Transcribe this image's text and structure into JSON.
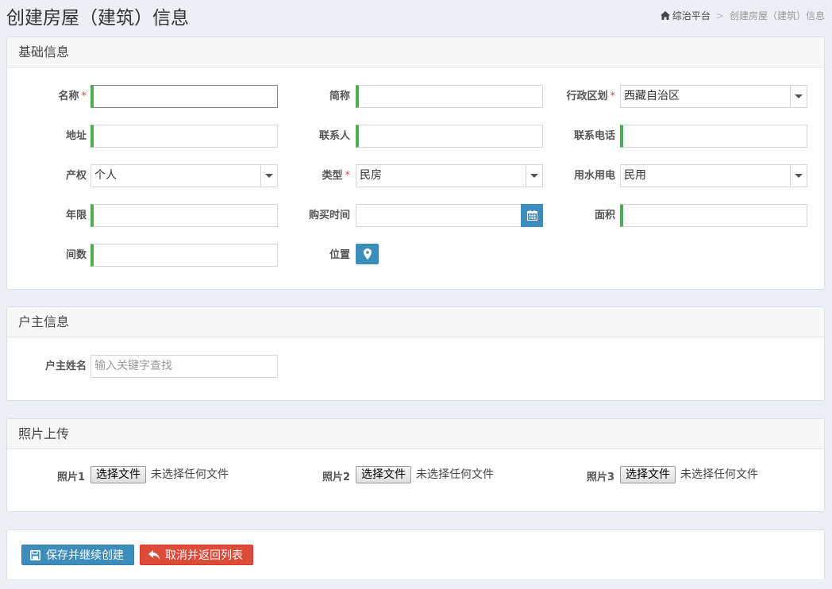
{
  "page": {
    "title": "创建房屋（建筑）信息",
    "breadcrumb": {
      "home": "综治平台",
      "sep": ">",
      "current": "创建房屋（建筑）信息"
    }
  },
  "basic": {
    "title": "基础信息",
    "fields": {
      "name": {
        "label": "名称",
        "required": "*",
        "value": ""
      },
      "short_name": {
        "label": "简称",
        "value": ""
      },
      "district": {
        "label": "行政区划",
        "required": "*",
        "value": "西藏自治区"
      },
      "address": {
        "label": "地址",
        "value": ""
      },
      "contact": {
        "label": "联系人",
        "value": ""
      },
      "phone": {
        "label": "联系电话",
        "value": ""
      },
      "ownership": {
        "label": "产权",
        "value": "个人"
      },
      "type": {
        "label": "类型",
        "required": "*",
        "value": "民房"
      },
      "utility": {
        "label": "用水用电",
        "value": "民用"
      },
      "years": {
        "label": "年限",
        "value": ""
      },
      "purchase_time": {
        "label": "购买时间",
        "value": ""
      },
      "area": {
        "label": "面积",
        "value": ""
      },
      "rooms": {
        "label": "间数",
        "value": ""
      },
      "location": {
        "label": "位置"
      }
    }
  },
  "owner": {
    "title": "户主信息",
    "name_label": "户主姓名",
    "name_placeholder": "输入关键字查找"
  },
  "photos": {
    "title": "照片上传",
    "items": [
      {
        "label": "照片1",
        "button": "选择文件",
        "status": "未选择任何文件"
      },
      {
        "label": "照片2",
        "button": "选择文件",
        "status": "未选择任何文件"
      },
      {
        "label": "照片3",
        "button": "选择文件",
        "status": "未选择任何文件"
      }
    ]
  },
  "actions": {
    "save": "保存并继续创建",
    "cancel": "取消并返回列表"
  },
  "colors": {
    "primary": "#3c8dbc",
    "danger": "#dd4b39",
    "valid": "#4cae4c"
  }
}
